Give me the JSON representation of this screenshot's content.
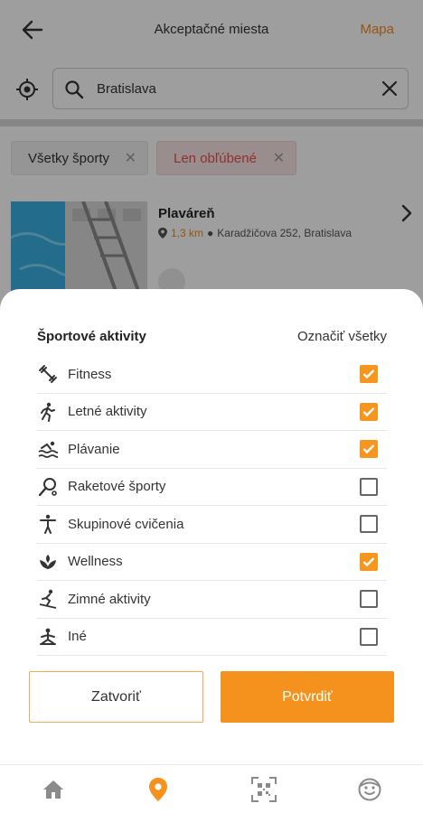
{
  "header": {
    "title": "Akceptačné miesta",
    "map_link": "Mapa"
  },
  "search": {
    "value": "Bratislava"
  },
  "filters": {
    "chips": [
      {
        "label": "Všetky športy"
      },
      {
        "label": "Len obľúbené"
      }
    ]
  },
  "result": {
    "title": "Plaváreň",
    "distance": "1,3 km",
    "address": "Karadžičova 252, Bratislava"
  },
  "sheet": {
    "title": "Športové aktivity",
    "mark_all": "Označiť všetky",
    "items": [
      {
        "label": "Fitness",
        "icon": "fitness-icon",
        "checked": true
      },
      {
        "label": "Letné aktivity",
        "icon": "running-icon",
        "checked": true
      },
      {
        "label": "Plávanie",
        "icon": "swimming-icon",
        "checked": true
      },
      {
        "label": "Raketové športy",
        "icon": "racket-icon",
        "checked": false
      },
      {
        "label": "Skupinové cvičenia",
        "icon": "group-exercise-icon",
        "checked": false
      },
      {
        "label": "Wellness",
        "icon": "wellness-icon",
        "checked": true
      },
      {
        "label": "Zimné aktivity",
        "icon": "skiing-icon",
        "checked": false
      },
      {
        "label": "Iné",
        "icon": "other-activity-icon",
        "checked": false
      }
    ],
    "close_label": "Zatvoriť",
    "confirm_label": "Potvrdiť"
  },
  "colors": {
    "accent": "#f5921e",
    "favorite_chip_text": "#e85050"
  }
}
